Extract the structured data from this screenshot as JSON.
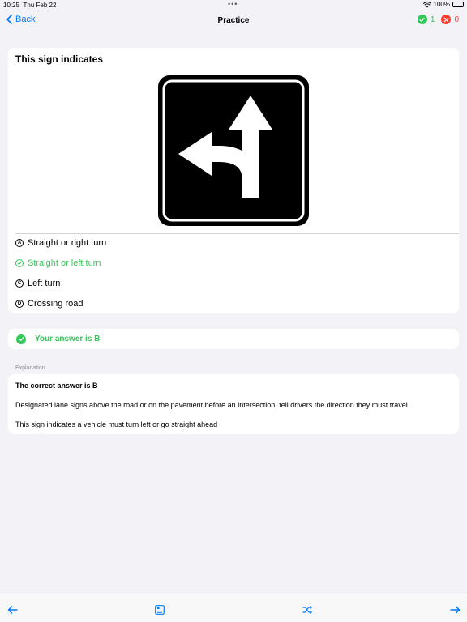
{
  "status": {
    "time": "10:25",
    "date": "Thu Feb 22",
    "battery": "100%"
  },
  "nav": {
    "back": "Back",
    "title": "Practice",
    "correct_count": "1",
    "wrong_count": "0"
  },
  "question": {
    "title": "This sign indicates",
    "options": [
      {
        "letter": "A",
        "text": "Straight or right turn"
      },
      {
        "letter": "B",
        "text": "Straight or left turn"
      },
      {
        "letter": "C",
        "text": "Left turn"
      },
      {
        "letter": "D",
        "text": "Crossing road"
      }
    ]
  },
  "answer": {
    "text": "Your answer is B"
  },
  "explanation": {
    "label": "Explanation",
    "title": "The correct answer is B",
    "p1": "Designated lane signs above the road or on the pavement before an intersection, tell drivers the direction they must travel.",
    "p2": "This sign indicates a vehicle must turn left or go straight ahead"
  },
  "colors": {
    "accent": "#007aff",
    "correct": "#34c759",
    "wrong": "#ff3b30"
  }
}
